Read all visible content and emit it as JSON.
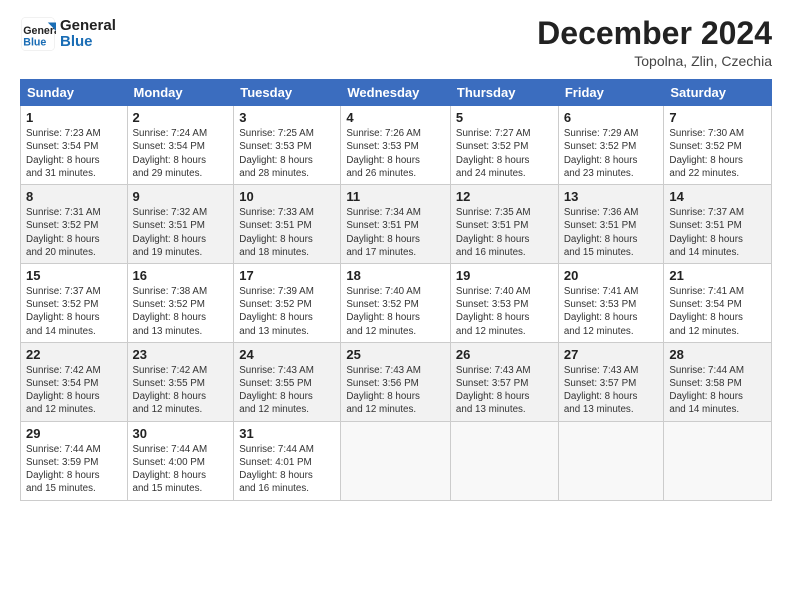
{
  "logo": {
    "text_general": "General",
    "text_blue": "Blue"
  },
  "header": {
    "month": "December 2024",
    "location": "Topolna, Zlin, Czechia"
  },
  "days_of_week": [
    "Sunday",
    "Monday",
    "Tuesday",
    "Wednesday",
    "Thursday",
    "Friday",
    "Saturday"
  ],
  "weeks": [
    [
      {
        "day": "1",
        "sunrise": "7:23 AM",
        "sunset": "3:54 PM",
        "daylight": "8 hours and 31 minutes."
      },
      {
        "day": "2",
        "sunrise": "7:24 AM",
        "sunset": "3:54 PM",
        "daylight": "8 hours and 29 minutes."
      },
      {
        "day": "3",
        "sunrise": "7:25 AM",
        "sunset": "3:53 PM",
        "daylight": "8 hours and 28 minutes."
      },
      {
        "day": "4",
        "sunrise": "7:26 AM",
        "sunset": "3:53 PM",
        "daylight": "8 hours and 26 minutes."
      },
      {
        "day": "5",
        "sunrise": "7:27 AM",
        "sunset": "3:52 PM",
        "daylight": "8 hours and 24 minutes."
      },
      {
        "day": "6",
        "sunrise": "7:29 AM",
        "sunset": "3:52 PM",
        "daylight": "8 hours and 23 minutes."
      },
      {
        "day": "7",
        "sunrise": "7:30 AM",
        "sunset": "3:52 PM",
        "daylight": "8 hours and 22 minutes."
      }
    ],
    [
      {
        "day": "8",
        "sunrise": "7:31 AM",
        "sunset": "3:52 PM",
        "daylight": "8 hours and 20 minutes."
      },
      {
        "day": "9",
        "sunrise": "7:32 AM",
        "sunset": "3:51 PM",
        "daylight": "8 hours and 19 minutes."
      },
      {
        "day": "10",
        "sunrise": "7:33 AM",
        "sunset": "3:51 PM",
        "daylight": "8 hours and 18 minutes."
      },
      {
        "day": "11",
        "sunrise": "7:34 AM",
        "sunset": "3:51 PM",
        "daylight": "8 hours and 17 minutes."
      },
      {
        "day": "12",
        "sunrise": "7:35 AM",
        "sunset": "3:51 PM",
        "daylight": "8 hours and 16 minutes."
      },
      {
        "day": "13",
        "sunrise": "7:36 AM",
        "sunset": "3:51 PM",
        "daylight": "8 hours and 15 minutes."
      },
      {
        "day": "14",
        "sunrise": "7:37 AM",
        "sunset": "3:51 PM",
        "daylight": "8 hours and 14 minutes."
      }
    ],
    [
      {
        "day": "15",
        "sunrise": "7:37 AM",
        "sunset": "3:52 PM",
        "daylight": "8 hours and 14 minutes."
      },
      {
        "day": "16",
        "sunrise": "7:38 AM",
        "sunset": "3:52 PM",
        "daylight": "8 hours and 13 minutes."
      },
      {
        "day": "17",
        "sunrise": "7:39 AM",
        "sunset": "3:52 PM",
        "daylight": "8 hours and 13 minutes."
      },
      {
        "day": "18",
        "sunrise": "7:40 AM",
        "sunset": "3:52 PM",
        "daylight": "8 hours and 12 minutes."
      },
      {
        "day": "19",
        "sunrise": "7:40 AM",
        "sunset": "3:53 PM",
        "daylight": "8 hours and 12 minutes."
      },
      {
        "day": "20",
        "sunrise": "7:41 AM",
        "sunset": "3:53 PM",
        "daylight": "8 hours and 12 minutes."
      },
      {
        "day": "21",
        "sunrise": "7:41 AM",
        "sunset": "3:54 PM",
        "daylight": "8 hours and 12 minutes."
      }
    ],
    [
      {
        "day": "22",
        "sunrise": "7:42 AM",
        "sunset": "3:54 PM",
        "daylight": "8 hours and 12 minutes."
      },
      {
        "day": "23",
        "sunrise": "7:42 AM",
        "sunset": "3:55 PM",
        "daylight": "8 hours and 12 minutes."
      },
      {
        "day": "24",
        "sunrise": "7:43 AM",
        "sunset": "3:55 PM",
        "daylight": "8 hours and 12 minutes."
      },
      {
        "day": "25",
        "sunrise": "7:43 AM",
        "sunset": "3:56 PM",
        "daylight": "8 hours and 12 minutes."
      },
      {
        "day": "26",
        "sunrise": "7:43 AM",
        "sunset": "3:57 PM",
        "daylight": "8 hours and 13 minutes."
      },
      {
        "day": "27",
        "sunrise": "7:43 AM",
        "sunset": "3:57 PM",
        "daylight": "8 hours and 13 minutes."
      },
      {
        "day": "28",
        "sunrise": "7:44 AM",
        "sunset": "3:58 PM",
        "daylight": "8 hours and 14 minutes."
      }
    ],
    [
      {
        "day": "29",
        "sunrise": "7:44 AM",
        "sunset": "3:59 PM",
        "daylight": "8 hours and 15 minutes."
      },
      {
        "day": "30",
        "sunrise": "7:44 AM",
        "sunset": "4:00 PM",
        "daylight": "8 hours and 15 minutes."
      },
      {
        "day": "31",
        "sunrise": "7:44 AM",
        "sunset": "4:01 PM",
        "daylight": "8 hours and 16 minutes."
      },
      null,
      null,
      null,
      null
    ]
  ],
  "labels": {
    "sunrise": "Sunrise:",
    "sunset": "Sunset:",
    "daylight": "Daylight:"
  }
}
